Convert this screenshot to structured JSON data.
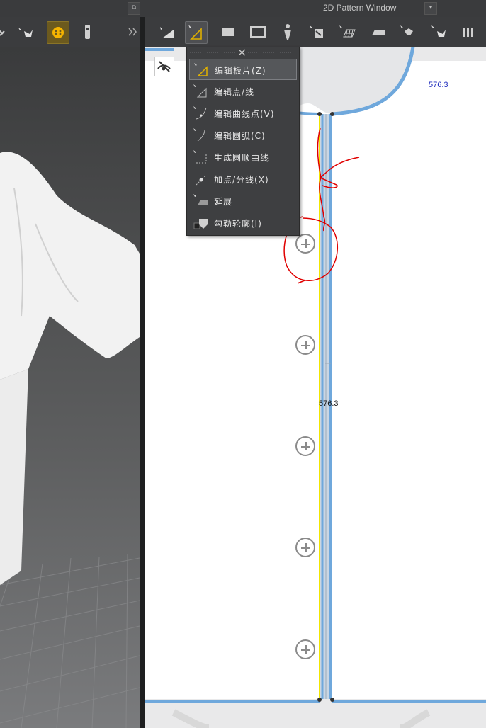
{
  "window": {
    "title": "2D Pattern Window",
    "detach_icon": "detach-icon",
    "dropdown_icon": "chevron-down-icon"
  },
  "menu": {
    "items": [
      {
        "label": "编辑板片(Z)",
        "icon": "edit-pattern-icon",
        "selected": true
      },
      {
        "label": "编辑点/线",
        "icon": "edit-point-line-icon",
        "selected": false
      },
      {
        "label": "编辑曲线点(V)",
        "icon": "edit-curve-point-icon",
        "selected": false
      },
      {
        "label": "编辑圆弧(C)",
        "icon": "edit-arc-icon",
        "selected": false
      },
      {
        "label": "生成圆顺曲线",
        "icon": "smooth-curve-icon",
        "selected": false
      },
      {
        "label": "加点/分线(X)",
        "icon": "add-point-icon",
        "selected": false
      },
      {
        "label": "延展",
        "icon": "extend-icon",
        "selected": false
      },
      {
        "label": "勾勒轮廓(I)",
        "icon": "trace-outline-icon",
        "selected": false
      }
    ]
  },
  "measurements": {
    "top_right": "576.3",
    "seam_length": "576.3"
  },
  "colors": {
    "background": "#2b2b2b",
    "toolbar": "#3b3c3e",
    "pattern_outline": "#6fa8dc",
    "seam_yellow": "#f2e600",
    "annotation_red": "#e00000",
    "measure_blue": "#1f2dbd"
  }
}
